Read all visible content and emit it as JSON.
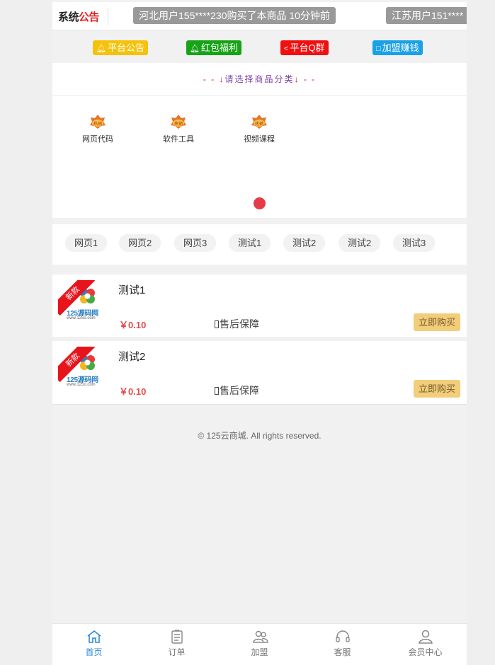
{
  "notice": {
    "logo_a": "系统",
    "logo_b": "公告",
    "tickers": [
      "河北用户155****230购买了本商品 10分钟前",
      "江苏用户151****"
    ]
  },
  "quick_links": [
    {
      "label": "平台公告",
      "icon": "bell-icon",
      "color": "#f4c20b"
    },
    {
      "label": "红包福利",
      "icon": "bell-icon",
      "color": "#16a316"
    },
    {
      "label": "平台Q群",
      "icon": "share-icon",
      "color": "#f11010"
    },
    {
      "label": "加盟赚钱",
      "icon": "broken-image-icon",
      "color": "#1aa1e6"
    }
  ],
  "category": {
    "header_dash_left": "- - ↓",
    "header_text": "请选择商品分类",
    "header_dash_right": "↓ - -",
    "items": [
      {
        "label": "网页代码",
        "icon": "hot-badge-icon",
        "badge": "热销"
      },
      {
        "label": "软件工具",
        "icon": "hot-badge-icon",
        "badge": "热销"
      },
      {
        "label": "视频课程",
        "icon": "hot-badge-icon",
        "badge": "热销"
      }
    ]
  },
  "tags": [
    "网页1",
    "网页2",
    "网页3",
    "测试1",
    "测试2",
    "测试2",
    "测试3"
  ],
  "products": [
    {
      "title": "测试1",
      "price": "￥0.10",
      "service": "售后保障",
      "buy_label": "立即购买",
      "ribbon": "新款",
      "brand_name": "125源码网",
      "brand_url": "www.125o.com"
    },
    {
      "title": "测试2",
      "price": "￥0.10",
      "service": "售后保障",
      "buy_label": "立即购买",
      "ribbon": "新款",
      "brand_name": "125源码网",
      "brand_url": "www.125o.com"
    }
  ],
  "footer": "© 125云商城. All rights reserved.",
  "tabbar": [
    {
      "label": "首页",
      "icon": "home-icon",
      "active": true
    },
    {
      "label": "订单",
      "icon": "order-icon",
      "active": false
    },
    {
      "label": "加盟",
      "icon": "group-icon",
      "active": false
    },
    {
      "label": "客服",
      "icon": "headset-icon",
      "active": false
    },
    {
      "label": "会员中心",
      "icon": "user-icon",
      "active": false
    }
  ],
  "colors": {
    "accent": "#2a8ad8",
    "price": "#e24b4b",
    "buy_button": "#f2cd7a",
    "carousel_dot": "#e53c47"
  }
}
